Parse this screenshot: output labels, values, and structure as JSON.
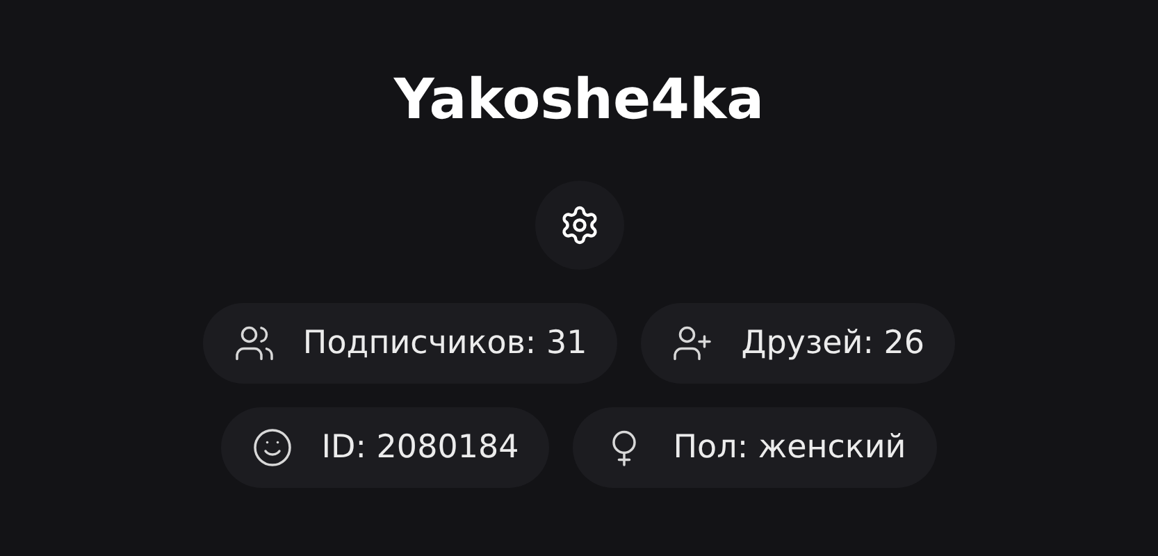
{
  "profile": {
    "username": "Yakoshe4ka"
  },
  "stats": [
    [
      {
        "kind": "followers",
        "text": "Подписчиков: 31"
      },
      {
        "kind": "friends",
        "text": "Друзей: 26"
      }
    ],
    [
      {
        "kind": "id",
        "text": "ID: 2080184"
      },
      {
        "kind": "gender",
        "text": "Пол: женский"
      }
    ]
  ]
}
